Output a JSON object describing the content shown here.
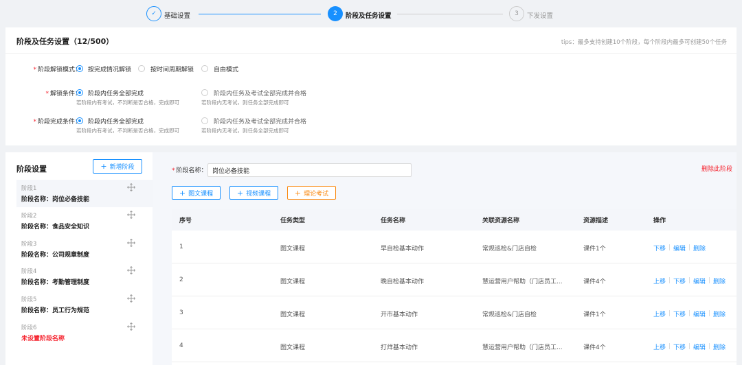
{
  "stepper": {
    "steps": [
      {
        "number": "✓",
        "label": "基础设置",
        "state": "done"
      },
      {
        "number": "2",
        "label": "阶段及任务设置",
        "state": "active"
      },
      {
        "number": "3",
        "label": "下发设置",
        "state": "pending"
      }
    ]
  },
  "settings": {
    "title": "阶段及任务设置（12/500）",
    "tips": "tips：最多支持创建10个阶段，每个阶段内最多可创建50个任务",
    "unlock_mode": {
      "label": "阶段解锁模式：",
      "options": [
        "按完成情况解锁",
        "按时间周期解锁",
        "自由模式"
      ],
      "selected": 0
    },
    "unlock_condition": {
      "label": "解锁条件：",
      "options": [
        {
          "text": "阶段内任务全部完成",
          "hint": "若阶段内有考试，不判断是否合格，完成即可"
        },
        {
          "text": "阶段内任务及考试全部完成并合格",
          "hint": "若阶段内无考试，则任务全部完成即可"
        }
      ],
      "selected": 0
    },
    "complete_condition": {
      "label": "阶段完成条件：",
      "options": [
        {
          "text": "阶段内任务全部完成",
          "hint": "若阶段内有考试，不判断是否合格，完成即可"
        },
        {
          "text": "阶段内任务及考试全部完成并合格",
          "hint": "若阶段内无考试，则任务全部完成即可"
        }
      ],
      "selected": 0
    }
  },
  "stages": {
    "title": "阶段设置",
    "add_button": "新增阶段",
    "items": [
      {
        "num": "阶段1",
        "name": "阶段名称：岗位必备技能",
        "active": true
      },
      {
        "num": "阶段2",
        "name": "阶段名称：食品安全知识"
      },
      {
        "num": "阶段3",
        "name": "阶段名称：公司规章制度"
      },
      {
        "num": "阶段4",
        "name": "阶段名称：考勤管理制度"
      },
      {
        "num": "阶段5",
        "name": "阶段名称：员工行为规范"
      },
      {
        "num": "阶段6",
        "name": "未设置阶段名称",
        "warn": true
      }
    ]
  },
  "editor": {
    "name_label": "阶段名称：",
    "name_value": "岗位必备技能",
    "delete_label": "删除此阶段",
    "buttons": [
      "图文课程",
      "视频课程",
      "理论考试"
    ],
    "columns": [
      "序号",
      "任务类型",
      "任务名称",
      "关联资源名称",
      "资源描述",
      "操作"
    ],
    "rows": [
      {
        "no": "1",
        "type": "图文课程",
        "name": "早自检基本动作",
        "resource": "常规巡检&门店自检",
        "desc": "课件1个",
        "ops": [
          "下移",
          "编辑",
          "删除"
        ]
      },
      {
        "no": "2",
        "type": "图文课程",
        "name": "晚自检基本动作",
        "resource": "慧运营用户帮助（门店员工...",
        "desc": "课件4个",
        "ops": [
          "上移",
          "下移",
          "编辑",
          "删除"
        ]
      },
      {
        "no": "3",
        "type": "图文课程",
        "name": "开市基本动作",
        "resource": "常规巡检&门店自检",
        "desc": "课件1个",
        "ops": [
          "上移",
          "下移",
          "编辑",
          "删除"
        ]
      },
      {
        "no": "4",
        "type": "图文课程",
        "name": "打烊基本动作",
        "resource": "慧运营用户帮助（门店员工...",
        "desc": "课件4个",
        "ops": [
          "上移",
          "下移",
          "编辑",
          "删除"
        ]
      }
    ]
  },
  "colors": {
    "primary": "#1890ff",
    "danger": "#f5222d",
    "orange": "#fa8c16"
  }
}
